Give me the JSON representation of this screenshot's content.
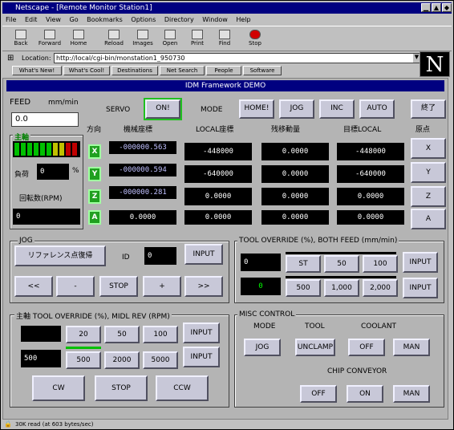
{
  "window": {
    "title": "Netscape - [Remote Monitor Station1]"
  },
  "menu": [
    "File",
    "Edit",
    "View",
    "Go",
    "Bookmarks",
    "Options",
    "Directory",
    "Window",
    "Help"
  ],
  "toolbar": [
    "Back",
    "Forward",
    "Home",
    "Reload",
    "Images",
    "Open",
    "Print",
    "Find",
    "Stop"
  ],
  "location": {
    "label": "Location:",
    "url": "http://local/cgi-bin/monstation1_950730"
  },
  "dirbuttons": [
    "What's New!",
    "What's Cool!",
    "Destinations",
    "Net Search",
    "People",
    "Software"
  ],
  "banner": "IDM Framework DEMO",
  "feed": {
    "label": "FEED",
    "unit": "mm/min",
    "value": "0.0"
  },
  "servo": {
    "label": "SERVO",
    "button": "ON!"
  },
  "mode": {
    "label": "MODE",
    "buttons": [
      "HOME!",
      "JOG",
      "INC",
      "AUTO"
    ],
    "exit": "終了"
  },
  "axis_headers": {
    "dir": "方向",
    "machine": "機械座標",
    "local": "LOCAL座標",
    "remain": "残移動量",
    "target": "目標LOCAL",
    "ref": "原点"
  },
  "axes": [
    {
      "name": "X",
      "machine": "-000000.563",
      "local": "-448000",
      "remain": "0.0000",
      "target": "-448000",
      "btn": "X"
    },
    {
      "name": "Y",
      "machine": "-000000.594",
      "local": "-640000",
      "remain": "0.0000",
      "target": "-640000",
      "btn": "Y"
    },
    {
      "name": "Z",
      "machine": "-000000.281",
      "local": "0.0000",
      "remain": "0.0000",
      "target": "0.0000",
      "btn": "Z"
    },
    {
      "name": "A",
      "machine": "0.0000",
      "local": "0.0000",
      "remain": "0.0000",
      "target": "0.0000",
      "btn": "A"
    }
  ],
  "spindle": {
    "label": "主軸",
    "load_label": "負荷",
    "load_value": "0",
    "load_unit": "%",
    "rpm_label": "回転数(RPM)",
    "rpm_value": "0"
  },
  "jog": {
    "title": "JOG",
    "ref_btn": "リファレンス点復帰",
    "id_label": "ID",
    "id_value": "0",
    "input": "INPUT",
    "buttons": [
      "<<",
      "-",
      "STOP",
      "+",
      ">>"
    ]
  },
  "tool": {
    "title": "TOOL OVERRIDE (%), BOTH FEED (mm/min)",
    "v1": "0",
    "v2": "0",
    "r1": [
      "ST",
      "50",
      "100"
    ],
    "r2": [
      "500",
      "1,000",
      "2,000"
    ],
    "input": "INPUT"
  },
  "spd": {
    "title": "主軸 TOOL OVERRIDE (%), MIDL REV (RPM)",
    "v1": "",
    "v2": "500",
    "r1": [
      "20",
      "50",
      "100"
    ],
    "r2": [
      "500",
      "2000",
      "5000"
    ],
    "input": "INPUT",
    "dir": [
      "CW",
      "STOP",
      "CCW"
    ]
  },
  "misc": {
    "title": "MISC CONTROL",
    "mode": "MODE",
    "tool": "TOOL",
    "coolant": "COOLANT",
    "jog": "JOG",
    "unclamp": "UNCLAMP",
    "off": "OFF",
    "man": "MAN",
    "chip": "CHIP CONVEYOR",
    "on": "ON"
  },
  "status": "30K read (at 603 bytes/sec)"
}
